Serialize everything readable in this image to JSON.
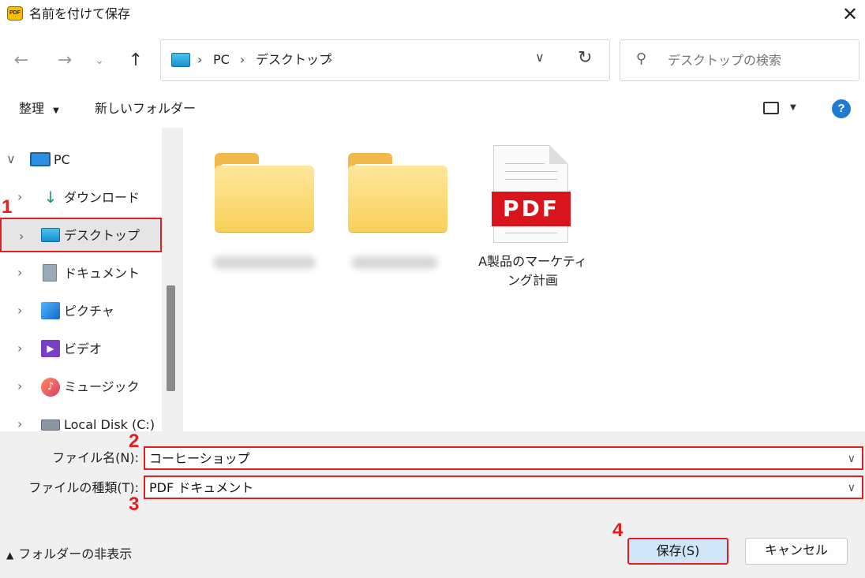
{
  "window": {
    "title": "名前を付けて保存",
    "app_icon_text": "PDF"
  },
  "nav": {
    "back_icon": "arrow-left-icon",
    "forward_icon": "arrow-right-icon",
    "up_icon": "arrow-up-icon"
  },
  "address": {
    "crumbs": [
      "PC",
      "デスクトップ"
    ]
  },
  "search": {
    "placeholder": "デスクトップの検索"
  },
  "toolbar": {
    "organize": "整理",
    "new_folder": "新しいフォルダー",
    "help": "?"
  },
  "sidebar": {
    "items": [
      {
        "label": "PC"
      },
      {
        "label": "ダウンロード"
      },
      {
        "label": "デスクトップ"
      },
      {
        "label": "ドキュメント"
      },
      {
        "label": "ピクチャ"
      },
      {
        "label": "ビデオ"
      },
      {
        "label": "ミュージック"
      },
      {
        "label": "Local Disk (C:)"
      }
    ]
  },
  "files": {
    "pdf_label_line1": "A製品のマーケティ",
    "pdf_label_line2": "ング計画",
    "pdf_badge": "PDF"
  },
  "form": {
    "filename_label": "ファイル名(N):",
    "filename_value": "コーヒーショップ",
    "filetype_label": "ファイルの種類(T):",
    "filetype_value": "PDF ドキュメント"
  },
  "buttons": {
    "save": "保存(S)",
    "cancel": "キャンセル",
    "hide_folders": "フォルダーの非表示"
  },
  "annotations": [
    "1",
    "2",
    "3",
    "4"
  ],
  "colors": {
    "highlight": "#e02020",
    "accent": "#1e7cd6",
    "pdf_red": "#d8141c",
    "folder": "#f8cf5a"
  }
}
